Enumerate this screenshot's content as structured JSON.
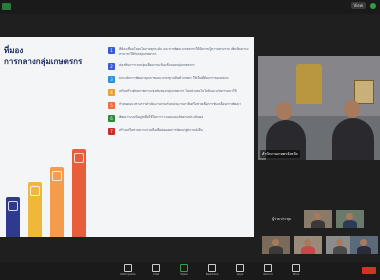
{
  "header": {
    "view_label": "View",
    "accent": "#2ea043"
  },
  "slide": {
    "title": "ที่มอง\nการกลางกลุ่มเกษตรกร",
    "points": [
      {
        "num": "1",
        "color": "#3b5bd6",
        "text": "ที่ต้องเชื่อมโยงนโยบายทุกระดับ และการพัฒนาเกษตรกรให้มีความรู้ความสามารถ เพิ่มขีดความสามารถให้กับกลุ่มเกษตรกร"
      },
      {
        "num": "2",
        "color": "#3b5bd6",
        "text": "ส่งเสริมการรวมกลุ่มเพื่อความเข้มแข็งของกลุ่มเกษตรกร"
      },
      {
        "num": "3",
        "color": "#2d8fd6",
        "text": "ยกระดับการพัฒนาคุณภาพและมาตรฐานสินค้าเกษตร ให้เป็นที่ต้องการของตลาด"
      },
      {
        "num": "4",
        "color": "#e8a03b",
        "text": "เสริมสร้างศักยภาพการแข่งขันของกลุ่มเกษตรกร โดยนำเทคโนโลยีและนวัตกรรมมาใช้"
      },
      {
        "num": "5",
        "color": "#f26b3a",
        "text": "กำหนดแนวทางการดำเนินงานร่วมกับหน่วยงานภาคีเครือข่ายเพื่อการขับเคลื่อนการพัฒนา"
      },
      {
        "num": "6",
        "color": "#2b8a3e",
        "text": "พัฒนาระบบข้อมูลเพื่อใช้ในการวางแผนและติดตามประเมินผล"
      },
      {
        "num": "7",
        "color": "#c92a2a",
        "text": "สร้างเครือข่ายความร่วมมือเพื่อต่อยอดการพัฒนาสู่ความยั่งยืน"
      }
    ],
    "bars": [
      {
        "color": "#2f3a8f",
        "height": 40
      },
      {
        "color": "#f0b83a",
        "height": 55
      },
      {
        "color": "#f39c4b",
        "height": 70
      },
      {
        "color": "#e85d3a",
        "height": 88
      }
    ]
  },
  "speaker": {
    "name": "สำนักงานเกษตรจังหวัด"
  },
  "participants": {
    "label": "ผู้ร่วมประชุม",
    "thumbs": [
      {
        "name": ""
      },
      {
        "name": ""
      },
      {
        "name": ""
      },
      {
        "name": ""
      },
      {
        "name": ""
      },
      {
        "name": ""
      }
    ]
  },
  "toolbar": {
    "items": [
      {
        "label": "Participants"
      },
      {
        "label": "Chat"
      },
      {
        "label": "Share"
      },
      {
        "label": "Reactions"
      },
      {
        "label": "Apps"
      },
      {
        "label": "Record"
      },
      {
        "label": "More"
      }
    ],
    "leave_color": "#d93025"
  }
}
